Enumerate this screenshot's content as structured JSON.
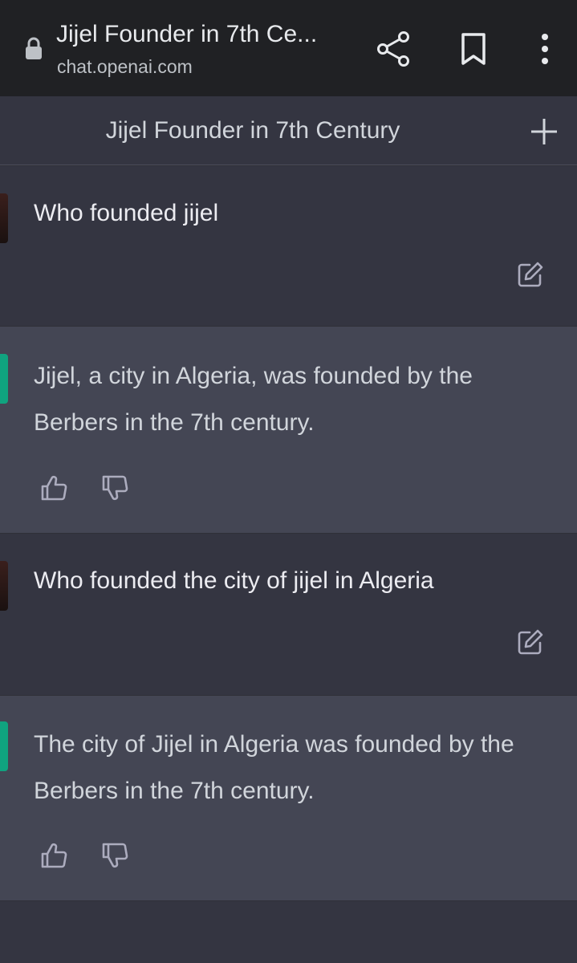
{
  "browser": {
    "tab_title": "Jijel Founder in 7th Ce...",
    "host": "chat.openai.com",
    "icons": [
      "lock-icon",
      "share-icon",
      "bookmark-icon",
      "menu-icon"
    ]
  },
  "chat": {
    "title": "Jijel Founder in 7th Century",
    "new_chat_icon": "plus-icon",
    "messages": [
      {
        "role": "user",
        "text": "Who founded jijel"
      },
      {
        "role": "assistant",
        "text": "Jijel, a city in Algeria, was founded by the Berbers in the 7th century."
      },
      {
        "role": "user",
        "text": "Who founded the city of jijel in Algeria"
      },
      {
        "role": "assistant",
        "text": "The city of Jijel in Algeria was founded by the Berbers in the 7th century."
      }
    ]
  },
  "colors": {
    "browser_bar": "#202124",
    "page_bg": "#343541",
    "assistant_bg": "#444654",
    "accent": "#10a37f",
    "text": "#d1d5db"
  }
}
